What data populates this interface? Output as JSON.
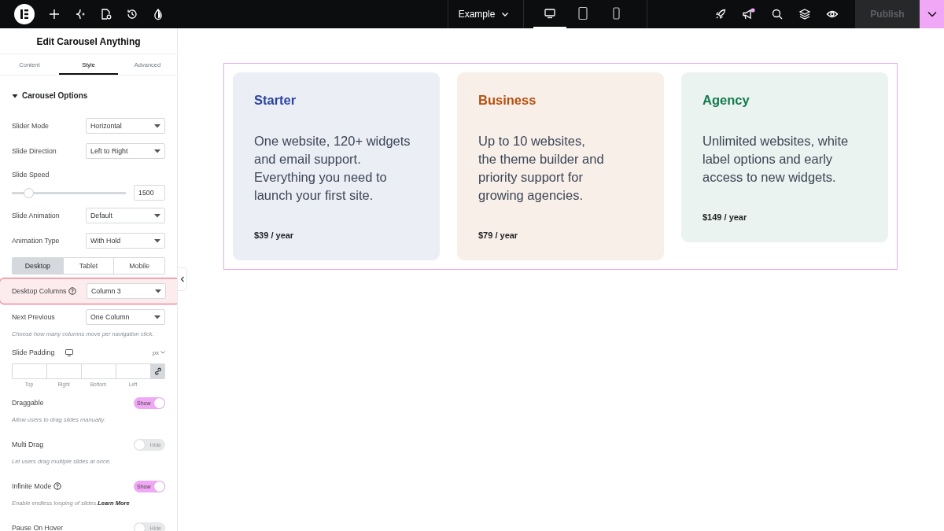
{
  "topbar": {
    "page": "Example",
    "devices": [
      {
        "kind": "desktop",
        "selected": true
      },
      {
        "kind": "tablet",
        "selected": false
      },
      {
        "kind": "mobile",
        "selected": false
      }
    ],
    "publish": {
      "label": "Publish",
      "disabled": true
    }
  },
  "panel": {
    "title": "Edit Carousel Anything",
    "tabs": [
      {
        "label": "Content",
        "selected": false
      },
      {
        "label": "Style",
        "selected": true
      },
      {
        "label": "Advanced",
        "selected": false
      }
    ],
    "section": {
      "title": "Carousel Options",
      "expanded": true
    },
    "controls": [
      {
        "kind": "select",
        "label": "Slider Mode",
        "value": "Horizontal",
        "help": false,
        "highlighted": false
      },
      {
        "kind": "select",
        "label": "Slide Direction",
        "value": "Left to Right",
        "help": false,
        "highlighted": false
      },
      {
        "kind": "slider",
        "label": "Slide Speed",
        "level": 0.15,
        "value": "1500"
      },
      {
        "kind": "select",
        "label": "Slide Animation",
        "value": "Default",
        "help": false,
        "highlighted": false
      },
      {
        "kind": "select",
        "label": "Animation Type",
        "value": "With Hold",
        "help": false,
        "highlighted": false
      },
      {
        "kind": "devices",
        "options": [
          {
            "label": "Desktop",
            "selected": true
          },
          {
            "label": "Tablet",
            "selected": false
          },
          {
            "label": "Mobile",
            "selected": false
          }
        ]
      },
      {
        "kind": "select",
        "label": "Desktop Columns",
        "value": "Column 3",
        "help": true,
        "highlighted": true
      },
      {
        "kind": "select",
        "label": "Next Previous",
        "value": "One Column",
        "help": false,
        "highlighted": false
      },
      {
        "kind": "note",
        "text": "Choose how many columns move per navigation click."
      },
      {
        "kind": "padding",
        "label": "Slide Padding",
        "unit": "px",
        "sides": [
          "Top",
          "Right",
          "Bottom",
          "Left"
        ]
      },
      {
        "kind": "toggle",
        "label": "Draggable",
        "text": "Show",
        "on": true,
        "help": false
      },
      {
        "kind": "note",
        "text": "Allow users to drag slides manually."
      },
      {
        "kind": "toggle",
        "label": "Multi Drag",
        "text": "Hide",
        "on": false,
        "help": false
      },
      {
        "kind": "note",
        "text": "Let users drag multiple slides at once."
      },
      {
        "kind": "toggle",
        "label": "Infinite Mode",
        "text": "Show",
        "on": true,
        "help": true
      },
      {
        "kind": "note",
        "text": "Enable endless looping of slides.",
        "link": "Learn More"
      },
      {
        "kind": "toggle",
        "label": "Pause On Hover",
        "text": "Hide",
        "on": false,
        "help": false
      }
    ]
  },
  "cards": [
    {
      "title": "Starter",
      "color": "#2b44a0",
      "lines": [
        "One website, 120+ widgets",
        "and email support.",
        "Everything you need to",
        "launch your first site."
      ],
      "price": "$39 / year"
    },
    {
      "title": "Business",
      "color": "#b5500f",
      "lines": [
        "Up to 10 websites,",
        "the theme builder and",
        "priority support for",
        "growing agencies."
      ],
      "price": "$79 / year"
    },
    {
      "title": "Agency",
      "color": "#137a4e",
      "lines": [
        "Unlimited websites, white",
        "label options and early",
        "access to new widgets."
      ],
      "price": "$149 / year"
    }
  ]
}
